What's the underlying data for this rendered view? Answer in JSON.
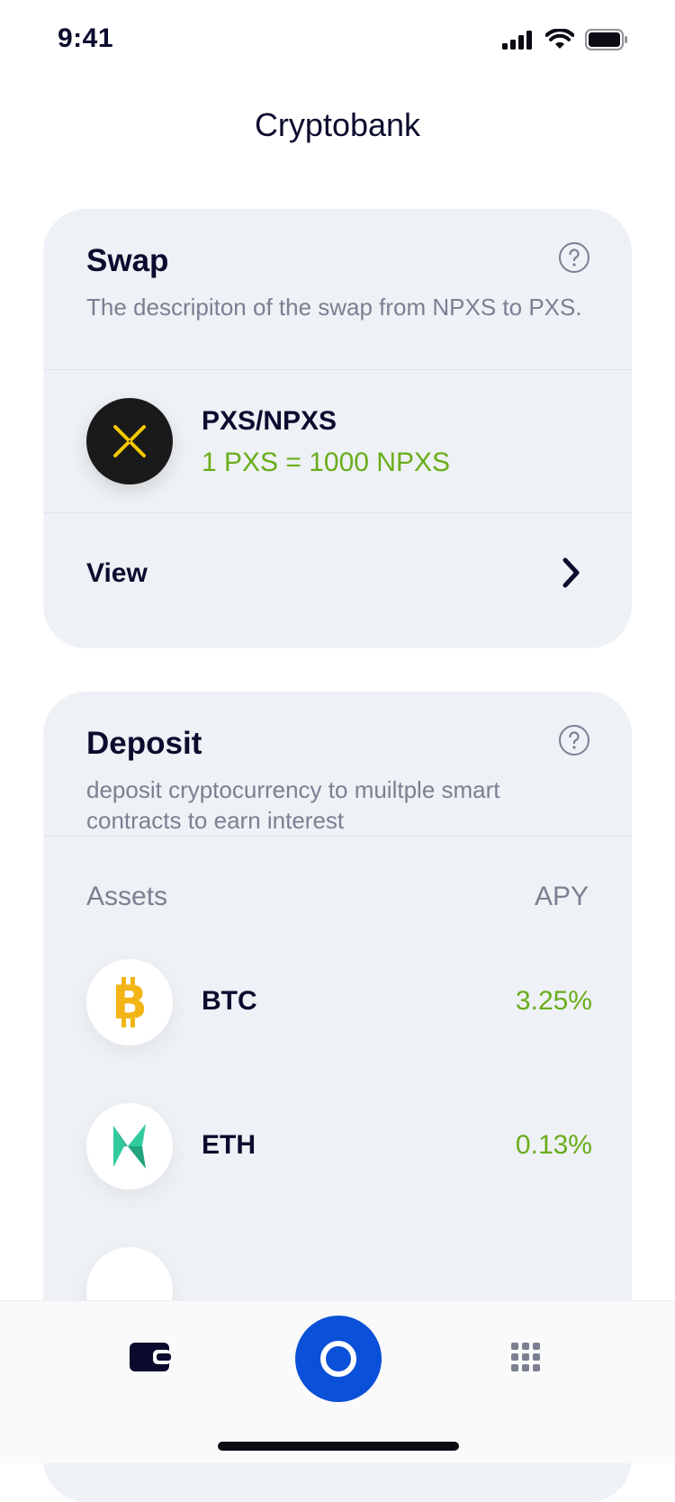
{
  "status_bar": {
    "time": "9:41"
  },
  "header": {
    "title": "Cryptobank"
  },
  "swap_card": {
    "title": "Swap",
    "description": "The descripiton of the swap from NPXS to PXS.",
    "pair": {
      "name": "PXS/NPXS",
      "rate": "1 PXS = 1000 NPXS",
      "icon": "pxs-coin-icon"
    },
    "view_label": "View"
  },
  "deposit_card": {
    "title": "Deposit",
    "description": "deposit cryptocurrency to muiltple smart contracts to earn interest",
    "columns": {
      "assets": "Assets",
      "apy": "APY"
    },
    "assets": [
      {
        "name": "BTC",
        "apy": "3.25%",
        "icon": "bitcoin-icon"
      },
      {
        "name": "ETH",
        "apy": "0.13%",
        "icon": "kyber-icon"
      }
    ]
  },
  "colors": {
    "accent": "#0b50d8",
    "positive": "#6aad1a",
    "card_bg": "#eef1f5",
    "text": "#0b0b2e",
    "muted": "#7b7f92"
  },
  "tab_bar": {
    "items": [
      "wallet-icon",
      "center-ring-icon",
      "apps-grid-icon"
    ]
  }
}
